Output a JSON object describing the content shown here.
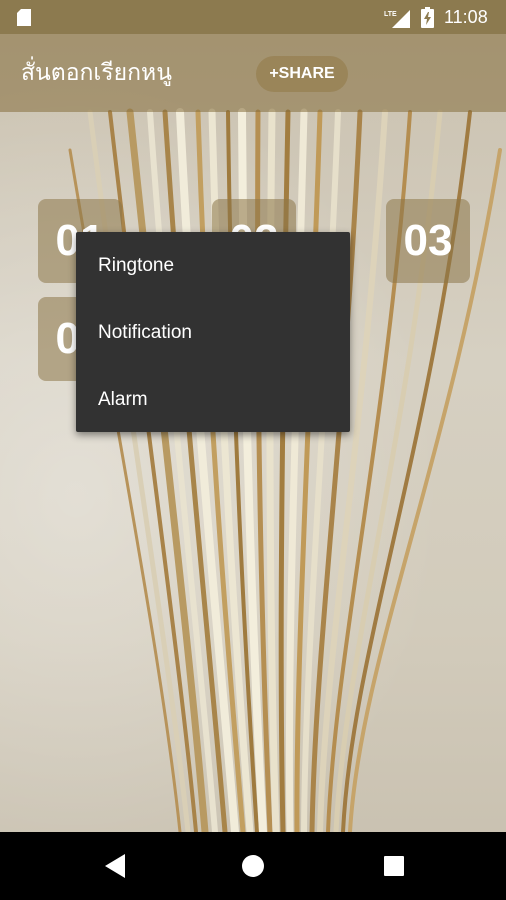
{
  "status_bar": {
    "time": "11:08",
    "network_label": "LTE",
    "icons": [
      "sd-card-icon",
      "lte-signal-icon",
      "battery-icon"
    ]
  },
  "app_bar": {
    "title": "สั่นตอกเรียกหนู",
    "share_label": "+SHARE"
  },
  "tiles": [
    "01",
    "02",
    "03",
    "04"
  ],
  "popup_menu": {
    "items": [
      "Ringtone",
      "Notification",
      "Alarm"
    ]
  },
  "nav_bar": {
    "icons": [
      "back-icon",
      "home-icon",
      "recents-icon"
    ]
  },
  "colors": {
    "status_bar": "#8c7a4f",
    "menu_background": "#323232",
    "text": "#ffffff",
    "nav_bar": "#000000"
  }
}
